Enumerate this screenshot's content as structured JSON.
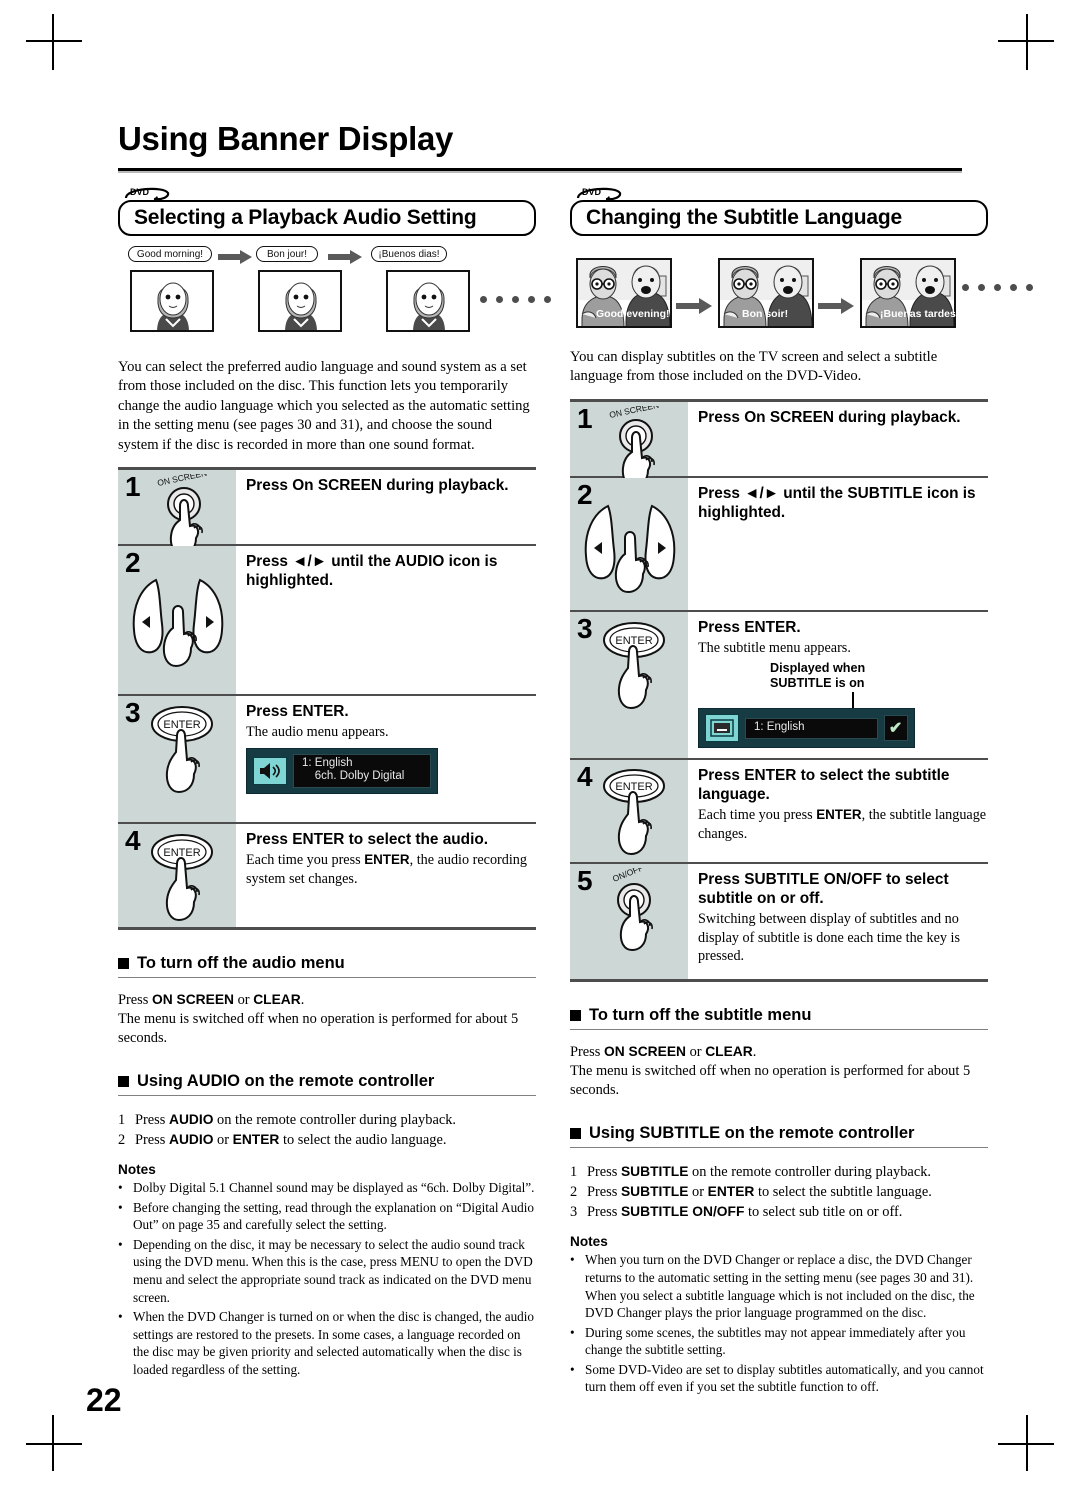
{
  "page": {
    "title": "Using Banner Display",
    "number": "22"
  },
  "left": {
    "badge": "DVD",
    "section_title": "Selecting a Playback Audio Setting",
    "illustration": {
      "bubbles": [
        "Good morning!",
        "Bon jour!",
        "¡Buenos dias!"
      ],
      "dots_count": 5
    },
    "intro": "You can select the preferred audio language and sound system as a set from those included on the disc. This function lets you temporarily change the audio language which you selected as the automatic setting in the setting menu (see pages 30 and 31), and choose the sound system if the disc is recorded in more than one sound format.",
    "steps": [
      {
        "num": "1",
        "key": "ON SCREEN",
        "key_type": "round",
        "title": "Press On SCREEN during playback.",
        "desc": ""
      },
      {
        "num": "2",
        "key": "",
        "key_type": "arrows",
        "title": "Press ◄/► until the AUDIO icon is highlighted.",
        "desc": ""
      },
      {
        "num": "3",
        "key": "ENTER",
        "key_type": "oval",
        "title": "Press ENTER.",
        "desc": "The audio menu appears.",
        "osd": {
          "icon": "speaker-icon",
          "line1": "1: English",
          "line2": "    6ch. Dolby Digital"
        }
      },
      {
        "num": "4",
        "key": "ENTER",
        "key_type": "oval",
        "title": "Press ENTER to select the audio.",
        "desc_pre": "Each time you press ",
        "desc_bold": "ENTER",
        "desc_post": ", the audio recording system set changes."
      }
    ],
    "subhead_turnoff": "To turn off the audio menu",
    "turnoff_line1_pre": "Press ",
    "turnoff_line1_b1": "ON SCREEN",
    "turnoff_line1_mid": " or ",
    "turnoff_line1_b2": "CLEAR",
    "turnoff_line1_post": ".",
    "turnoff_line2": "The menu is switched off when no operation is performed for about 5 seconds.",
    "subhead_remote": "Using AUDIO on the remote controller",
    "remote_steps": [
      {
        "n": "1",
        "pre": "Press ",
        "b1": "AUDIO",
        "post": " on the remote controller during playback."
      },
      {
        "n": "2",
        "pre": "Press ",
        "b1": "AUDIO",
        "mid": " or ",
        "b2": "ENTER",
        "post": " to select the audio language."
      }
    ],
    "notes_label": "Notes",
    "notes": [
      "Dolby Digital 5.1 Channel sound may be displayed as “6ch. Dolby Digital”.",
      "Before changing the setting, read through the explanation on “Digital Audio Out” on page 35 and carefully select the setting.",
      "Depending on the disc, it may be necessary to select the audio sound track using the DVD menu. When this is the case, press MENU to open the DVD menu and select the appropriate sound track as indicated on the DVD menu screen.",
      "When the DVD Changer is turned on or when the disc is changed, the audio settings are restored to the presets. In some cases, a language recorded on the disc may be given priority and selected automatically when the disc is loaded regardless of the setting."
    ]
  },
  "right": {
    "badge": "DVD",
    "section_title": "Changing the Subtitle Language",
    "illustration": {
      "captions": [
        "Good evening!",
        "Bon soir!",
        "¡Buenas tardes!"
      ],
      "dots_count": 5
    },
    "intro": "You can display subtitles on the TV screen and select a subtitle language from those included on the DVD-Video.",
    "steps": [
      {
        "num": "1",
        "key": "ON SCREEN",
        "key_type": "round",
        "title": "Press On SCREEN during playback.",
        "desc": ""
      },
      {
        "num": "2",
        "key": "",
        "key_type": "arrows",
        "title": "Press ◄/► until the SUBTITLE icon is highlighted.",
        "desc": ""
      },
      {
        "num": "3",
        "key": "ENTER",
        "key_type": "oval",
        "title": "Press ENTER.",
        "desc": "The subtitle menu appears.",
        "callout": "Displayed when\nSUBTITLE is on",
        "osd": {
          "icon": "subtitle-icon",
          "line1": "1: English",
          "check": "✔"
        }
      },
      {
        "num": "4",
        "key": "ENTER",
        "key_type": "oval",
        "title": "Press ENTER to select the subtitle language.",
        "desc_pre": "Each time you press ",
        "desc_bold": "ENTER",
        "desc_post": ", the subtitle language changes."
      },
      {
        "num": "5",
        "key": "ON/OFF",
        "key_type": "round",
        "title": "Press SUBTITLE ON/OFF to select subtitle on or off.",
        "desc": "Switching between display of subtitles and no display of subtitle is done each time the key is pressed."
      }
    ],
    "subhead_turnoff": "To turn off the subtitle menu",
    "turnoff_line1_pre": "Press ",
    "turnoff_line1_b1": "ON SCREEN",
    "turnoff_line1_mid": " or ",
    "turnoff_line1_b2": "CLEAR",
    "turnoff_line1_post": ".",
    "turnoff_line2": "The menu is switched off when no operation is performed for about 5 seconds.",
    "subhead_remote": "Using SUBTITLE on the remote controller",
    "remote_steps": [
      {
        "n": "1",
        "pre": "Press ",
        "b1": "SUBTITLE",
        "post": " on the remote controller during playback."
      },
      {
        "n": "2",
        "pre": "Press ",
        "b1": "SUBTITLE",
        "mid": " or ",
        "b2": "ENTER",
        "post": " to select the subtitle language."
      },
      {
        "n": "3",
        "pre": "Press ",
        "b1": "SUBTITLE ON/OFF",
        "post": " to select sub title on or off."
      }
    ],
    "notes_label": "Notes",
    "notes": [
      "When you turn on the DVD Changer or replace a disc, the DVD Changer returns to the automatic setting in the setting menu (see pages 30 and 31). When you select a subtitle language which is not included on the disc, the DVD Changer plays the prior language programmed on the disc.",
      "During some scenes, the subtitles may not appear immediately after you change the subtitle setting.",
      "Some DVD-Video are set to display subtitles automatically, and you cannot turn them off even if you set the subtitle function to off."
    ]
  }
}
